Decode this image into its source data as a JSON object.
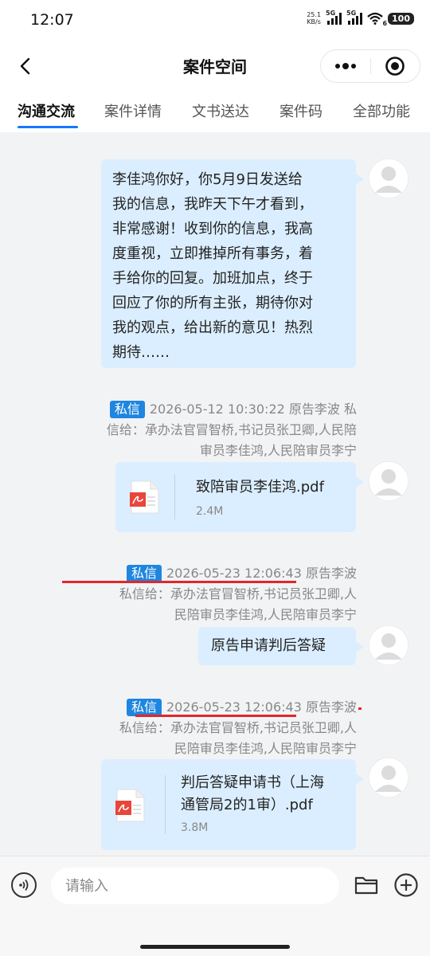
{
  "status_bar": {
    "time": "12:07",
    "net_speed_value": "25.1",
    "net_speed_unit": "KB/s",
    "signal1_label": "5G",
    "signal2_label": "5G",
    "wifi_label": "6",
    "battery": "100"
  },
  "nav": {
    "title": "案件空间",
    "more_icon": "ellipsis-icon",
    "record_icon": "target-icon"
  },
  "tabs": [
    {
      "label": "沟通交流",
      "active": true
    },
    {
      "label": "案件详情",
      "active": false
    },
    {
      "label": "文书送达",
      "active": false
    },
    {
      "label": "案件码",
      "active": false
    },
    {
      "label": "全部功能",
      "active": false
    }
  ],
  "messages": [
    {
      "type": "text",
      "lines": [
        "李佳鸿你好，你5月9日发送给",
        "我的信息，我昨天下午才看到，",
        "非常感谢！收到你的信息，我高",
        "度重视，立即推掉所有事务，着",
        "手给你的回复。加班加点，终于",
        "回应了你的所有主张，期待你对",
        "我的观点，给出新的意见！热烈",
        "期待……"
      ]
    },
    {
      "type": "file",
      "badge": "私信",
      "time": "2026-05-12 10:30:22",
      "meta_line1_rest": "原告李波  私",
      "meta_line2": "信给：承办法官冒智桥,书记员张卫卿,人民陪",
      "meta_line3": "审员李佳鸿,人民陪审员李宁",
      "file_name": "致陪审员李佳鸿.pdf",
      "file_size": "2.4M"
    },
    {
      "type": "text",
      "badge": "私信",
      "time": "2026-05-23 12:06:43",
      "meta_line1_rest": "原告李波",
      "meta_line2": "私信给：承办法官冒智桥,书记员张卫卿,人",
      "meta_line3": "民陪审员李佳鸿,人民陪审员李宁",
      "text": "原告申请判后答疑"
    },
    {
      "type": "file",
      "badge": "私信",
      "time": "2026-05-23 12:06:43",
      "meta_line1_rest": "原告李波",
      "meta_line2": "私信给：承办法官冒智桥,书记员张卫卿,人",
      "meta_line3": "民陪审员李佳鸿,人民陪审员李宁",
      "file_name_line1": "判后答疑申请书（上海",
      "file_name_line2": "通管局2的1审）.pdf",
      "file_size": "3.8M"
    }
  ],
  "input_bar": {
    "placeholder": "请输入",
    "voice_icon": "voice-icon",
    "folder_icon": "folder-icon",
    "plus_icon": "plus-circle-icon"
  },
  "colors": {
    "accent": "#1677ff",
    "badge": "#1f86e0",
    "bubble": "#dbeeff",
    "annotation_red": "#e3262a",
    "pdf_red": "#e8463b"
  }
}
